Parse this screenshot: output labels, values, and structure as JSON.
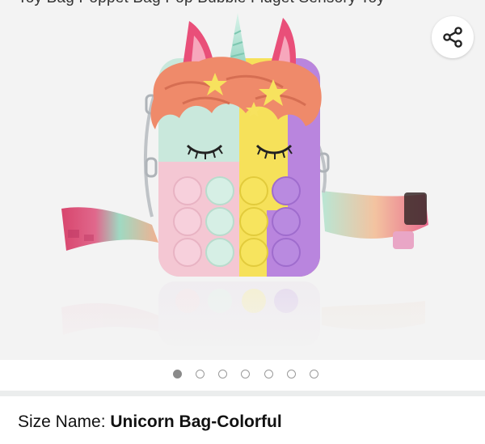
{
  "product": {
    "title": "Toy Bag Poppet Bag Pop Bubble Fidget Sensory Toy"
  },
  "gallery": {
    "share_icon": "share-icon",
    "image_count": 7,
    "active_index": 0
  },
  "size": {
    "label": "Size Name: ",
    "value": "Unicorn Bag-Colorful"
  },
  "colors": {
    "background": "#f3f3f3",
    "dot_active": "#8a8a8a",
    "dot_inactive": "#9a9a9a"
  }
}
